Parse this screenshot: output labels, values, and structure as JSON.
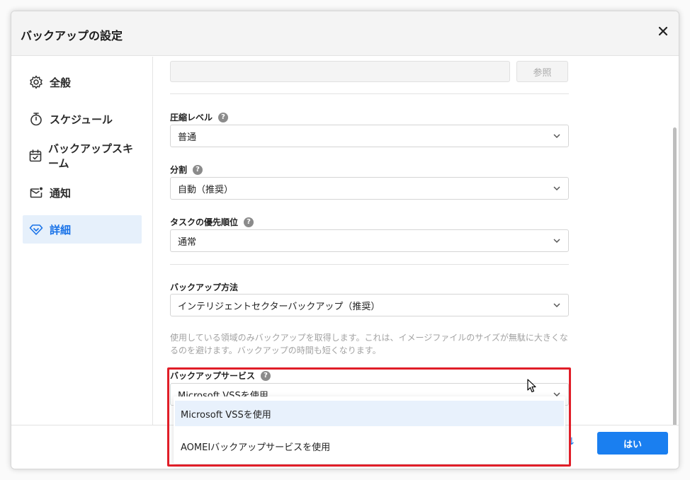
{
  "dialog": {
    "title": "バックアップの設定"
  },
  "sidebar": {
    "items": [
      {
        "label": "全般",
        "icon": "gear-icon"
      },
      {
        "label": "スケジュール",
        "icon": "stopwatch-icon"
      },
      {
        "label": "バックアップスキーム",
        "icon": "calendar-check-icon"
      },
      {
        "label": "通知",
        "icon": "mail-icon"
      },
      {
        "label": "詳細",
        "icon": "diamond-icon",
        "active": true
      }
    ]
  },
  "main": {
    "browse_label": "参照",
    "compression": {
      "label": "圧縮レベル",
      "value": "普通"
    },
    "split": {
      "label": "分割",
      "value": "自動（推奨）"
    },
    "priority": {
      "label": "タスクの優先順位",
      "value": "通常"
    },
    "backup_method": {
      "label": "バックアップ方法",
      "value": "インテリジェントセクターバックアップ（推奨）",
      "description": "使用している領域のみバックアップを取得します。これは、イメージファイルのサイズが無駄に大きくなるのを避けます。バックアップの時間も短くなります。"
    },
    "backup_service": {
      "label": "バックアップサービス",
      "value": "Microsoft VSSを使用",
      "options": [
        "Microsoft VSSを使用",
        "AOMEIバックアップサービスを使用"
      ]
    }
  },
  "footer": {
    "ok_label": "はい"
  },
  "colors": {
    "accent": "#1a7ff0",
    "highlight": "#e01e28"
  }
}
